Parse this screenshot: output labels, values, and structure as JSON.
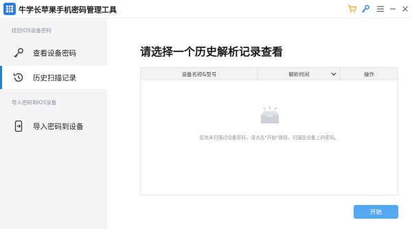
{
  "app": {
    "title": "牛学长苹果手机密码管理工具",
    "logo_icon": "grid-logo-icon",
    "accent_color": "#2a7de1"
  },
  "titlebar": {
    "icons": [
      "cart-icon",
      "key-icon",
      "menu-icon",
      "minimize-icon",
      "close-icon"
    ]
  },
  "sidebar": {
    "section1_label": "找回iOS设备密码",
    "items": [
      {
        "label": "查看设备密码",
        "icon": "key-icon",
        "active": false
      },
      {
        "label": "历史扫描记录",
        "icon": "history-icon",
        "active": true
      }
    ],
    "section2_label": "导入密码到iOS设备",
    "import_item": {
      "label": "导入密码到设备",
      "icon": "phone-import-icon"
    }
  },
  "main": {
    "title": "请选择一个历史解析记录查看",
    "table": {
      "columns": [
        "设备名称&型号",
        "解析时间",
        "操作"
      ],
      "rows": []
    },
    "empty_message": "您尚未扫描过设备密码，请点击\"开始\"按钮，扫描您设备上的密码。",
    "start_button": "开始",
    "button_color": "#55a8f2"
  }
}
